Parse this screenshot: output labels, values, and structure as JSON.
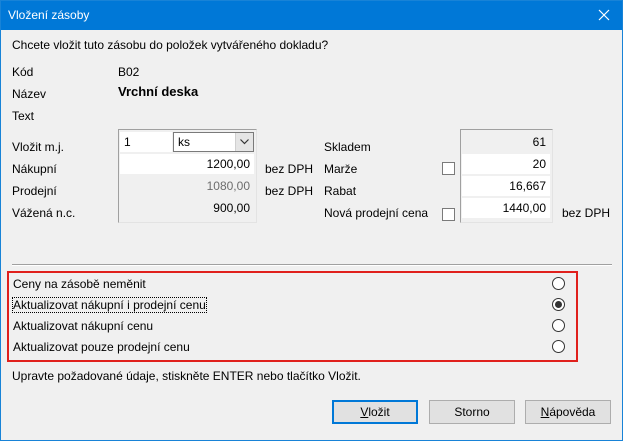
{
  "window": {
    "title": "Vložení zásoby"
  },
  "prompt": "Chcete vložit tuto zásobu do položek vytvářeného dokladu?",
  "info": {
    "kod_label": "Kód",
    "kod_value": "B02",
    "nazev_label": "Název",
    "nazev_value": "Vrchní deska",
    "text_label": "Text"
  },
  "left": {
    "vlozit_label": "Vložit m.j.",
    "vlozit_qty": "1",
    "unit": "ks",
    "nakupni_label": "Nákupní",
    "nakupni_value": "1200,00",
    "nakupni_suffix": "bez DPH",
    "prodejni_label": "Prodejní",
    "prodejni_value": "1080,00",
    "prodejni_suffix": "bez DPH",
    "vazena_label": "Vážená n.c.",
    "vazena_value": "900,00"
  },
  "right": {
    "skladem_label": "Skladem",
    "skladem_value": "61",
    "marze_label": "Marže",
    "marze_value": "20",
    "marze_checked": false,
    "rabat_label": "Rabat",
    "rabat_value": "16,667",
    "nova_label": "Nová prodejní cena",
    "nova_value": "1440,00",
    "nova_suffix": "bez DPH",
    "nova_checked": false
  },
  "options": [
    {
      "label": "Ceny na zásobě neměnit",
      "selected": false
    },
    {
      "label": "Aktualizovat nákupní i prodejní cenu",
      "selected": true
    },
    {
      "label": "Aktualizovat nákupní cenu",
      "selected": false
    },
    {
      "label": "Aktualizovat pouze prodejní cenu",
      "selected": false
    }
  ],
  "hint": "Upravte požadované údaje, stiskněte ENTER nebo tlačítko Vložit.",
  "buttons": {
    "insert": {
      "accel": "V",
      "rest": "ložit"
    },
    "cancel": "Storno",
    "help": {
      "accel": "N",
      "rest": "ápověda"
    }
  },
  "colors": {
    "titlebar": "#0078d7",
    "highlight_box": "#e0201c"
  },
  "icons": {
    "close": "close-icon",
    "dropdown": "chevron-down-icon"
  }
}
